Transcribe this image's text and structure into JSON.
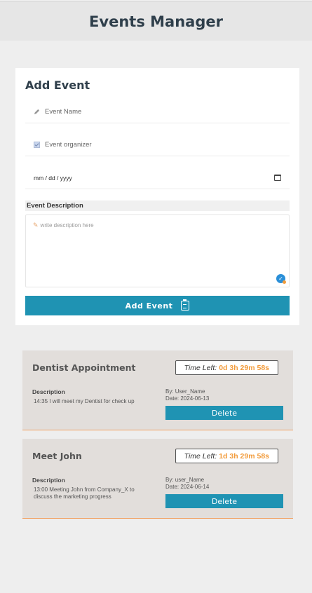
{
  "header": {
    "title": "Events Manager"
  },
  "form": {
    "title": "Add Event",
    "name_placeholder": "Event Name",
    "organizer_placeholder": "Event organizer",
    "date_placeholder": "mm / dd / yyyy",
    "description_label": "Event Description",
    "description_placeholder": "write description here",
    "submit_label": "Add Event"
  },
  "events": [
    {
      "title": "Dentist Appointment",
      "time_left_label": "Time Left:",
      "time_left_value": "0d 3h 29m 58s",
      "description_label": "Description",
      "description": "14:35 I will meet my Dentist for check up",
      "by": "By: User_Name",
      "date": "Date: 2024-06-13",
      "delete_label": "Delete"
    },
    {
      "title": "Meet John",
      "time_left_label": "Time Left:",
      "time_left_value": "1d 3h 29m 58s",
      "description_label": "Description",
      "description": "13:00 Meeting John from Company_X to discuss the marketing progress",
      "by": "By: user_Name",
      "date": "Date: 2024-06-14",
      "delete_label": "Delete"
    }
  ],
  "colors": {
    "accent": "#1f93b3",
    "highlight": "#f29b3b",
    "card_bg": "#e2dedb",
    "page_bg": "#eeeeee"
  },
  "icons": {
    "name_field": "pencil-icon",
    "organizer_field": "checkbox-icon",
    "date_field": "calendar-icon",
    "description": "pencil-icon",
    "submit": "clipboard-icon",
    "grammar": "grammar-check-icon"
  }
}
